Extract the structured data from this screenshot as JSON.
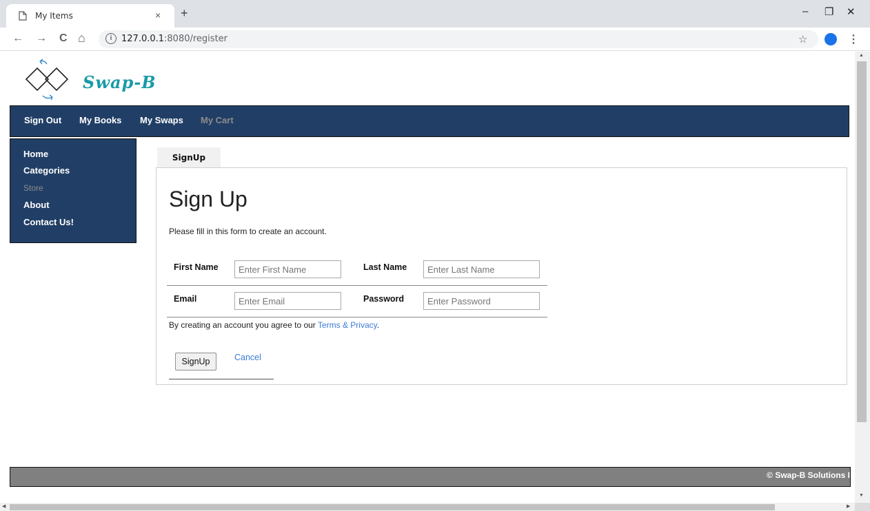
{
  "browser": {
    "tab_title": "My Items",
    "tab_close": "×",
    "new_tab": "+",
    "url_host": "127.0.0.1",
    "url_path": ":8080/register",
    "info_icon": "i",
    "back": "←",
    "forward": "→",
    "reload": "C",
    "home": "⌂",
    "star": "☆",
    "menu": "⋮",
    "minimize": "–",
    "restore": "❐",
    "close": "✕"
  },
  "logo": {
    "text": "Swap-B"
  },
  "navbar": {
    "items": [
      "Sign Out",
      "My Books",
      "My Swaps",
      "My Cart"
    ]
  },
  "sidebar": {
    "items": [
      "Home",
      "Categories",
      "Store",
      "About",
      "Contact Us!"
    ]
  },
  "tab": {
    "label": "SignUp"
  },
  "form": {
    "heading": "Sign Up",
    "intro": "Please fill in this form to create an account.",
    "first_name_label": "First Name",
    "first_name_placeholder": "Enter First Name",
    "last_name_label": "Last Name",
    "last_name_placeholder": "Enter Last Name",
    "email_label": "Email",
    "email_placeholder": "Enter Email",
    "password_label": "Password",
    "password_placeholder": "Enter Password",
    "terms_prefix": "By creating an account you agree to our",
    "terms_link": "Terms & Privacy",
    "terms_suffix": ".",
    "signup_button": "SignUp",
    "cancel_link": "Cancel"
  },
  "footer": {
    "text": "© Swap-B Solutions I"
  },
  "colors": {
    "nav_bg": "#213f66",
    "dim_text": "#8c8c8c",
    "link": "#3a7bd5",
    "logo": "#1a9aa8",
    "footer_bg": "#808080"
  }
}
